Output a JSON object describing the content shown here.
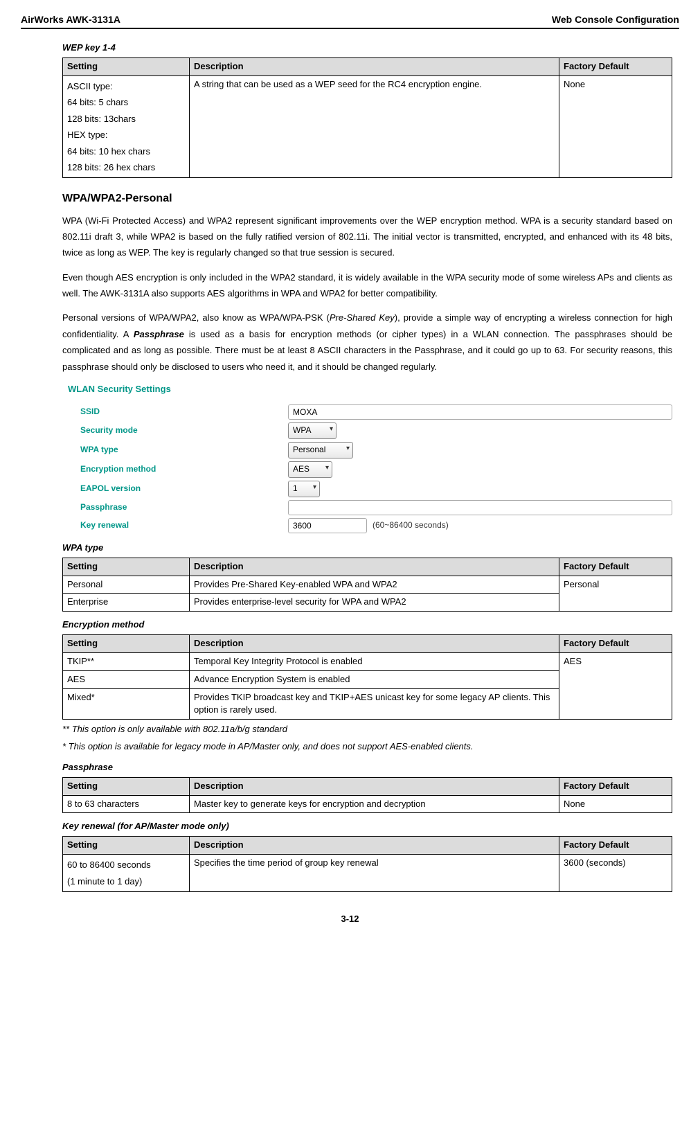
{
  "header": {
    "left": "AirWorks AWK-3131A",
    "right": "Web Console Configuration"
  },
  "wep_table": {
    "caption": "WEP key 1-4",
    "head": [
      "Setting",
      "Description",
      "Factory Default"
    ],
    "setting_lines": [
      "ASCII type:",
      "64 bits: 5 chars",
      "128 bits: 13chars",
      "HEX type:",
      "64 bits: 10 hex chars",
      "128 bits: 26 hex chars"
    ],
    "description": "A string that can be used as a WEP seed for the RC4 encryption engine.",
    "default": "None"
  },
  "wpa_section": {
    "title": "WPA/WPA2-Personal",
    "p1": "WPA (Wi-Fi Protected Access) and WPA2 represent significant improvements over the WEP encryption method. WPA is a security standard based on 802.11i draft 3, while WPA2 is based on the fully ratified version of 802.11i. The initial vector is transmitted, encrypted, and enhanced with its 48 bits, twice as long as WEP. The key is regularly changed so that true session is secured.",
    "p2": "Even though AES encryption is only included in the WPA2 standard, it is widely available in the WPA security mode of some wireless APs and clients as well. The AWK-3131A also supports AES algorithms in WPA and WPA2 for better compatibility.",
    "p3_a": "Personal versions of WPA/WPA2, also know as WPA/WPA-PSK (",
    "p3_psk": "Pre-Shared Key",
    "p3_b": "), provide a simple way of encrypting a wireless connection for high confidentiality. A ",
    "p3_pass": "Passphrase",
    "p3_c": " is used as a basis for encryption methods (or cipher types) in a WLAN connection. The passphrases should be complicated and as long as possible. There must be at least 8 ASCII characters in the Passphrase, and it could go up to 63. For security reasons, this passphrase should only be disclosed to users who need it, and it should be changed regularly."
  },
  "wlan": {
    "title": "WLAN Security Settings",
    "labels": {
      "ssid": "SSID",
      "mode": "Security mode",
      "wpa_type": "WPA type",
      "enc": "Encryption method",
      "eapol": "EAPOL version",
      "pass": "Passphrase",
      "renew": "Key renewal"
    },
    "values": {
      "ssid": "MOXA",
      "mode": "WPA",
      "wpa_type": "Personal",
      "enc": "AES",
      "eapol": "1",
      "pass": "",
      "renew": "3600",
      "renew_hint": "(60~86400 seconds)"
    }
  },
  "wpa_type_table": {
    "caption": "WPA type",
    "head": [
      "Setting",
      "Description",
      "Factory Default"
    ],
    "rows": [
      {
        "s": "Personal",
        "d": "Provides Pre-Shared Key-enabled WPA and WPA2"
      },
      {
        "s": "Enterprise",
        "d": "Provides enterprise-level security for WPA and WPA2"
      }
    ],
    "default": "Personal"
  },
  "enc_table": {
    "caption": "Encryption method",
    "head": [
      "Setting",
      "Description",
      "Factory Default"
    ],
    "rows": [
      {
        "s": "TKIP**",
        "d": "Temporal Key Integrity Protocol is enabled"
      },
      {
        "s": "AES",
        "d": "Advance Encryption System is enabled"
      },
      {
        "s": "Mixed*",
        "d": "Provides TKIP broadcast key and TKIP+AES unicast key for some legacy AP clients. This option is rarely used."
      }
    ],
    "default": "AES",
    "note1": "** This option is only available with 802.11a/b/g standard",
    "note2": "* This option is available for legacy mode in AP/Master only, and does not support AES-enabled clients."
  },
  "pass_table": {
    "caption": "Passphrase",
    "head": [
      "Setting",
      "Description",
      "Factory Default"
    ],
    "row": {
      "s": "8 to 63 characters",
      "d": "Master key to generate keys for encryption and decryption",
      "f": "None"
    }
  },
  "key_table": {
    "caption": "Key renewal (for AP/Master mode only)",
    "head": [
      "Setting",
      "Description",
      "Factory Default"
    ],
    "row": {
      "s1": "60 to 86400 seconds",
      "s2": "(1 minute to 1 day)",
      "d": "Specifies the time period of group key renewal",
      "f": "3600 (seconds)"
    }
  },
  "page_num": "3-12"
}
